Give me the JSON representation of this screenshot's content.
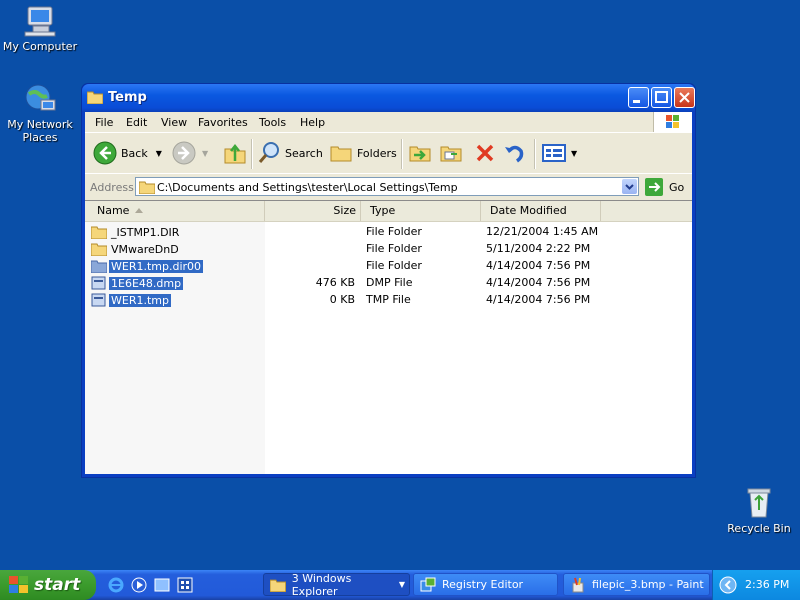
{
  "desktop": {
    "icons": [
      {
        "label": "My Computer"
      },
      {
        "label": "My Network Places"
      },
      {
        "label": "Recycle Bin"
      }
    ]
  },
  "window": {
    "title": "Temp",
    "menu": [
      "File",
      "Edit",
      "View",
      "Favorites",
      "Tools",
      "Help"
    ],
    "toolbar": {
      "back_label": "Back",
      "search_label": "Search",
      "folders_label": "Folders"
    },
    "address": {
      "label": "Address",
      "value": "C:\\Documents and Settings\\tester\\Local Settings\\Temp",
      "go_label": "Go"
    },
    "columns": [
      "Name",
      "Size",
      "Type",
      "Date Modified"
    ],
    "files": [
      {
        "name": "_ISTMP1.DIR",
        "size": "",
        "type": "File Folder",
        "date": "12/21/2004 1:45 AM",
        "kind": "folder",
        "selected": false
      },
      {
        "name": "VMwareDnD",
        "size": "",
        "type": "File Folder",
        "date": "5/11/2004 2:22 PM",
        "kind": "folder",
        "selected": false
      },
      {
        "name": "WER1.tmp.dir00",
        "size": "",
        "type": "File Folder",
        "date": "4/14/2004 7:56 PM",
        "kind": "folder",
        "selected": true
      },
      {
        "name": "1E6E48.dmp",
        "size": "476 KB",
        "type": "DMP File",
        "date": "4/14/2004 7:56 PM",
        "kind": "file",
        "selected": true
      },
      {
        "name": "WER1.tmp",
        "size": "0 KB",
        "type": "TMP File",
        "date": "4/14/2004 7:56 PM",
        "kind": "file",
        "selected": true
      }
    ]
  },
  "taskbar": {
    "start_label": "start",
    "tasks": [
      {
        "label": "3 Windows Explorer"
      },
      {
        "label": "Registry Editor"
      },
      {
        "label": "filepic_3.bmp - Paint"
      }
    ],
    "clock": "2:36 PM"
  },
  "colors": {
    "desktop": "#0a4fa8",
    "selection": "#316ac5",
    "titlebar": "#0a58e0",
    "start_green": "#3b9b2c"
  }
}
